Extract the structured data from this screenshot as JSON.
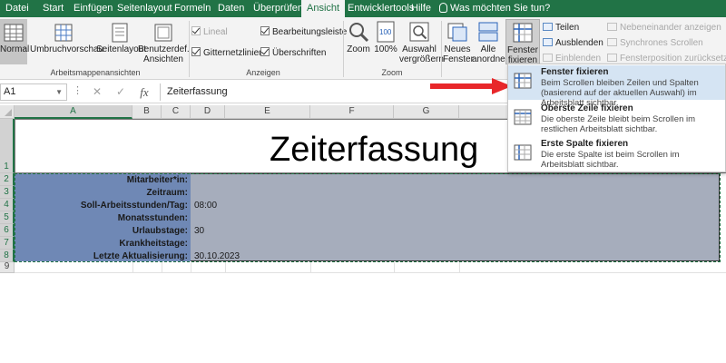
{
  "menu_tabs": [
    "Datei",
    "Start",
    "Einfügen",
    "Seitenlayout",
    "Formeln",
    "Daten",
    "Überprüfen",
    "Ansicht",
    "Entwicklertools",
    "Hilfe"
  ],
  "active_tab": "Ansicht",
  "tell_me": "Was möchten Sie tun?",
  "ribbon": {
    "views": {
      "normal": "Normal",
      "umbruch": "Umbruchvorschau",
      "seitenlayout": "Seitenlayout",
      "benutzerdef": "Benutzerdef.",
      "benutzerdef2": "Ansichten",
      "group": "Arbeitsmappenansichten"
    },
    "show": {
      "lineal": "Lineal",
      "gitternetz": "Gitternetzlinien",
      "bearbeitung": "Bearbeitungsleiste",
      "ueberschriften": "Überschriften",
      "group": "Anzeigen"
    },
    "zoom": {
      "zoom": "Zoom",
      "hundred": "100%",
      "auswahl1": "Auswahl",
      "auswahl2": "vergrößern",
      "group": "Zoom"
    },
    "window": {
      "neues1": "Neues",
      "neues2": "Fenster",
      "alle1": "Alle",
      "alle2": "anordnen",
      "fixieren1": "Fenster",
      "fixieren2": "fixieren ▾",
      "teilen": "Teilen",
      "ausblenden": "Ausblenden",
      "einblenden": "Einblenden",
      "nebeneinander": "Nebeneinander anzeigen",
      "synchron": "Synchrones Scrollen",
      "position": "Fensterposition zurücksetzen"
    }
  },
  "formula_bar": {
    "name_box": "A1",
    "formula": "Zeiterfassung"
  },
  "columns": [
    "A",
    "B",
    "C",
    "D",
    "E",
    "F",
    "G"
  ],
  "rows": [
    "1",
    "2",
    "3",
    "4",
    "5",
    "6",
    "7",
    "8",
    "9"
  ],
  "sheet": {
    "title": "Zeiterfassung",
    "fields": [
      {
        "label": "Mitarbeiter*in:",
        "value": ""
      },
      {
        "label": "Zeitraum:",
        "value": ""
      },
      {
        "label": "Soll-Arbeitsstunden/Tag:",
        "value": "08:00"
      },
      {
        "label": "Monatsstunden:",
        "value": ""
      },
      {
        "label": "Urlaubstage:",
        "value": "30"
      },
      {
        "label": "Krankheitstage:",
        "value": ""
      },
      {
        "label": "Letzte Aktualisierung:",
        "value": "30.10.2023"
      }
    ]
  },
  "freeze_menu": [
    {
      "title": "Fenster fixieren",
      "desc": "Beim Scrollen bleiben Zeilen und Spalten (basierend auf der aktuellen Auswahl) im Arbeitsblatt sichtbar."
    },
    {
      "title": "Oberste Zeile fixieren",
      "desc": "Die oberste Zeile bleibt beim Scrollen im restlichen Arbeitsblatt sichtbar."
    },
    {
      "title": "Erste Spalte fixieren",
      "desc": "Die erste Spalte ist beim Scrollen im Arbeitsblatt sichtbar."
    }
  ],
  "colors": {
    "excel_green": "#217346",
    "arrow_red": "#e8272a",
    "label_blue": "#6f88b5",
    "value_gray": "#a6adbc"
  }
}
